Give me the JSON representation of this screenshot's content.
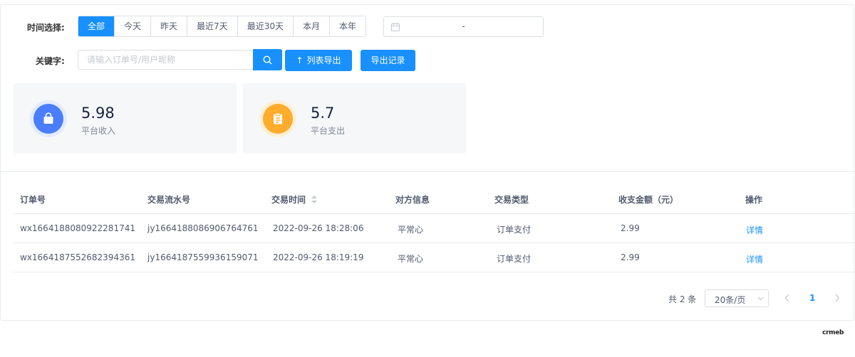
{
  "filters": {
    "time_label": "时间选择:",
    "time_options": [
      "全部",
      "今天",
      "昨天",
      "最近7天",
      "最近30天",
      "本月",
      "本年"
    ],
    "time_selected": "全部",
    "date_range_separator": "-",
    "keyword_label": "关键字:",
    "keyword_placeholder": "请输入订单号/用户昵称",
    "keyword_value": ""
  },
  "actions": {
    "export_list": "列表导出",
    "export_records": "导出记录"
  },
  "stats": [
    {
      "value": "5.98",
      "label": "平台收入",
      "icon": "shopping-bag-icon",
      "color": "#4a7dff"
    },
    {
      "value": "5.7",
      "label": "平台支出",
      "icon": "clipboard-icon",
      "color": "#ffab2b"
    }
  ],
  "table": {
    "columns": [
      "订单号",
      "交易流水号",
      "交易时间",
      "对方信息",
      "交易类型",
      "收支金额（元）",
      "操作"
    ],
    "rows": [
      {
        "order_no": "wx1664188080922281741",
        "serial_no": "jy1664188086906764761",
        "time": "2022-09-26 18:28:06",
        "counterparty": "平常心",
        "type": "订单支付",
        "amount": "2.99",
        "action": "详情"
      },
      {
        "order_no": "wx1664187552682394361",
        "serial_no": "jy1664187559936159071",
        "time": "2022-09-26 18:19:19",
        "counterparty": "平常心",
        "type": "订单支付",
        "amount": "2.99",
        "action": "详情"
      }
    ]
  },
  "pagination": {
    "total": "共 2 条",
    "page_size": "20条/页",
    "current_page": "1"
  },
  "brand": "crmeb",
  "colors": {
    "primary": "#1890ff"
  }
}
